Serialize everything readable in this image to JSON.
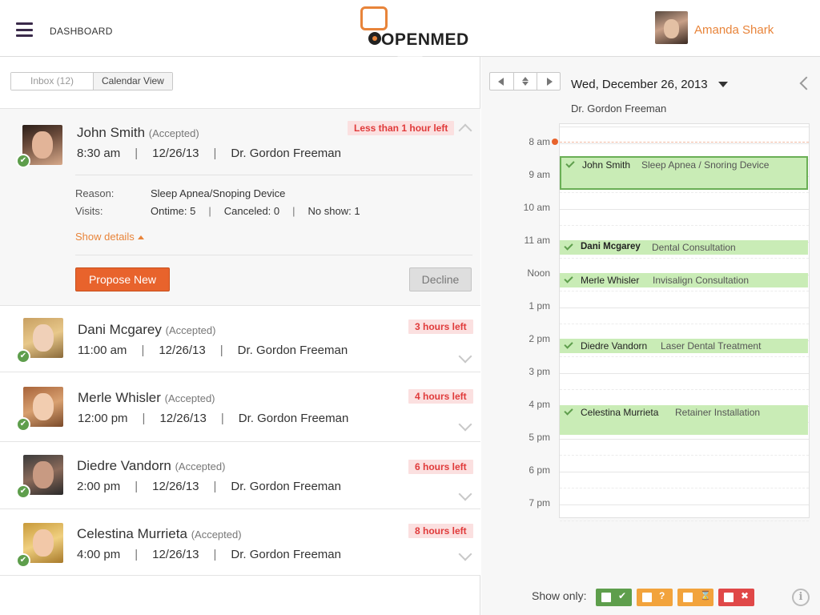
{
  "header": {
    "nav_label": "DASHBOARD",
    "brand": "OPENMED",
    "user_name": "Amanda Shark"
  },
  "left": {
    "tabs": [
      {
        "label": "Inbox (12)"
      },
      {
        "label": "Calendar View"
      }
    ],
    "appointments": [
      {
        "name": "John Smith",
        "status": "(Accepted)",
        "time": "8:30 am",
        "date": "12/26/13",
        "doctor": "Dr. Gordon Freeman",
        "time_left": "Less than 1 hour left",
        "details": {
          "reason_label": "Reason:",
          "reason": "Sleep Apnea/Snoping Device",
          "visits_label": "Visits:",
          "ontime": "Ontime: 5",
          "canceled": "Canceled: 0",
          "noshow": "No show: 1",
          "show_details": "Show details",
          "propose": "Propose New",
          "decline": "Decline"
        }
      },
      {
        "name": "Dani Mcgarey",
        "status": "(Accepted)",
        "time": "11:00 am",
        "date": "12/26/13",
        "doctor": "Dr. Gordon Freeman",
        "time_left": "3 hours left"
      },
      {
        "name": "Merle Whisler",
        "status": "(Accepted)",
        "time": "12:00 pm",
        "date": "12/26/13",
        "doctor": "Dr. Gordon Freeman",
        "time_left": "4 hours left"
      },
      {
        "name": "Diedre Vandorn",
        "status": "(Accepted)",
        "time": "2:00 pm",
        "date": "12/26/13",
        "doctor": "Dr. Gordon Freeman",
        "time_left": "6 hours left"
      },
      {
        "name": "Celestina Murrieta",
        "status": "(Accepted)",
        "time": "4:00 pm",
        "date": "12/26/13",
        "doctor": "Dr. Gordon Freeman",
        "time_left": "8 hours left"
      }
    ]
  },
  "calendar": {
    "date": "Wed, December 26, 2013",
    "doctor": "Dr. Gordon Freeman",
    "hours": [
      "8 am",
      "9 am",
      "10 am",
      "11 am",
      "Noon",
      "1 pm",
      "2 pm",
      "3 pm",
      "4 pm",
      "5 pm",
      "6 pm",
      "7 pm"
    ],
    "events": [
      {
        "name": "John Smith",
        "desc": "Sleep Apnea / Snoring Device"
      },
      {
        "name": "Dani Mcgarey",
        "desc": "Dental Consultation"
      },
      {
        "name": "Merle Whisler",
        "desc": "Invisalign Consultation"
      },
      {
        "name": "Diedre Vandorn",
        "desc": "Laser Dental Treatment"
      },
      {
        "name": "Celestina Murrieta",
        "desc": "Retainer Installation"
      }
    ],
    "show_only_label": "Show only:",
    "filters": [
      {
        "symbol": "✔",
        "color": "#5e9e4c"
      },
      {
        "symbol": "?",
        "color": "#f2a33c"
      },
      {
        "symbol": "⌛",
        "color": "#f2a33c"
      },
      {
        "symbol": "✖",
        "color": "#e04848"
      }
    ],
    "info_symbol": "i"
  },
  "colors": {
    "accent": "#e8843a",
    "primary_button": "#e8632c",
    "accepted_green": "#5e9e4c",
    "event_fill": "#c9ecb6",
    "urgent_red": "#e03a3a"
  }
}
